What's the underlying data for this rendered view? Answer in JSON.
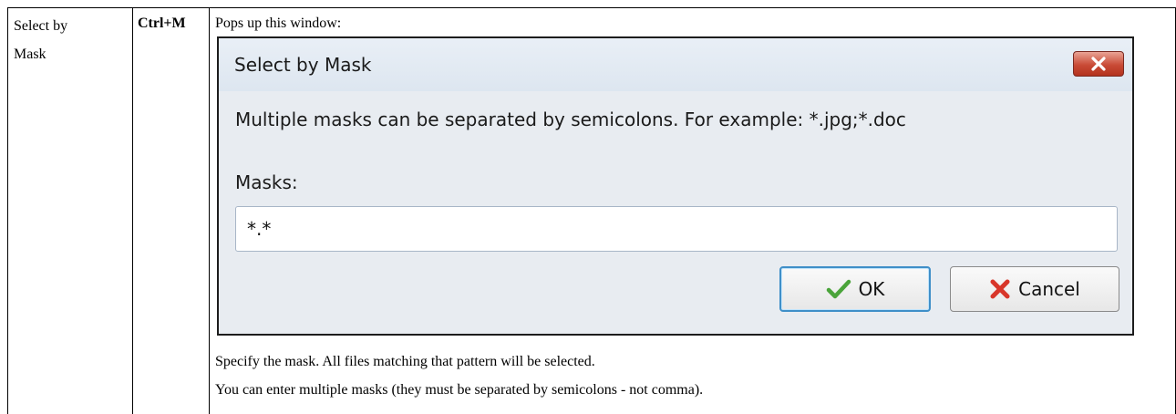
{
  "table": {
    "command": "Select by Mask",
    "command_line1": "Select by",
    "command_line2": "Mask",
    "shortcut": "Ctrl+M",
    "intro": "Pops up this window:",
    "notes": [
      "Specify the mask. All files matching that pattern will be selected.",
      "You can enter multiple masks (they must be separated by semicolons - not comma)."
    ]
  },
  "dialog": {
    "title": "Select by Mask",
    "close_icon": "close-x-icon",
    "info": "Multiple masks can be separated by semicolons. For example: *.jpg;*.doc",
    "masks_label": "Masks:",
    "masks_value": "*.*",
    "ok_label": "OK",
    "ok_icon": "checkmark-icon",
    "cancel_label": "Cancel",
    "cancel_icon": "red-x-icon"
  },
  "colors": {
    "ok_check": "#4aa43a",
    "cancel_x": "#d8362a",
    "close_button": "#c94b36"
  }
}
